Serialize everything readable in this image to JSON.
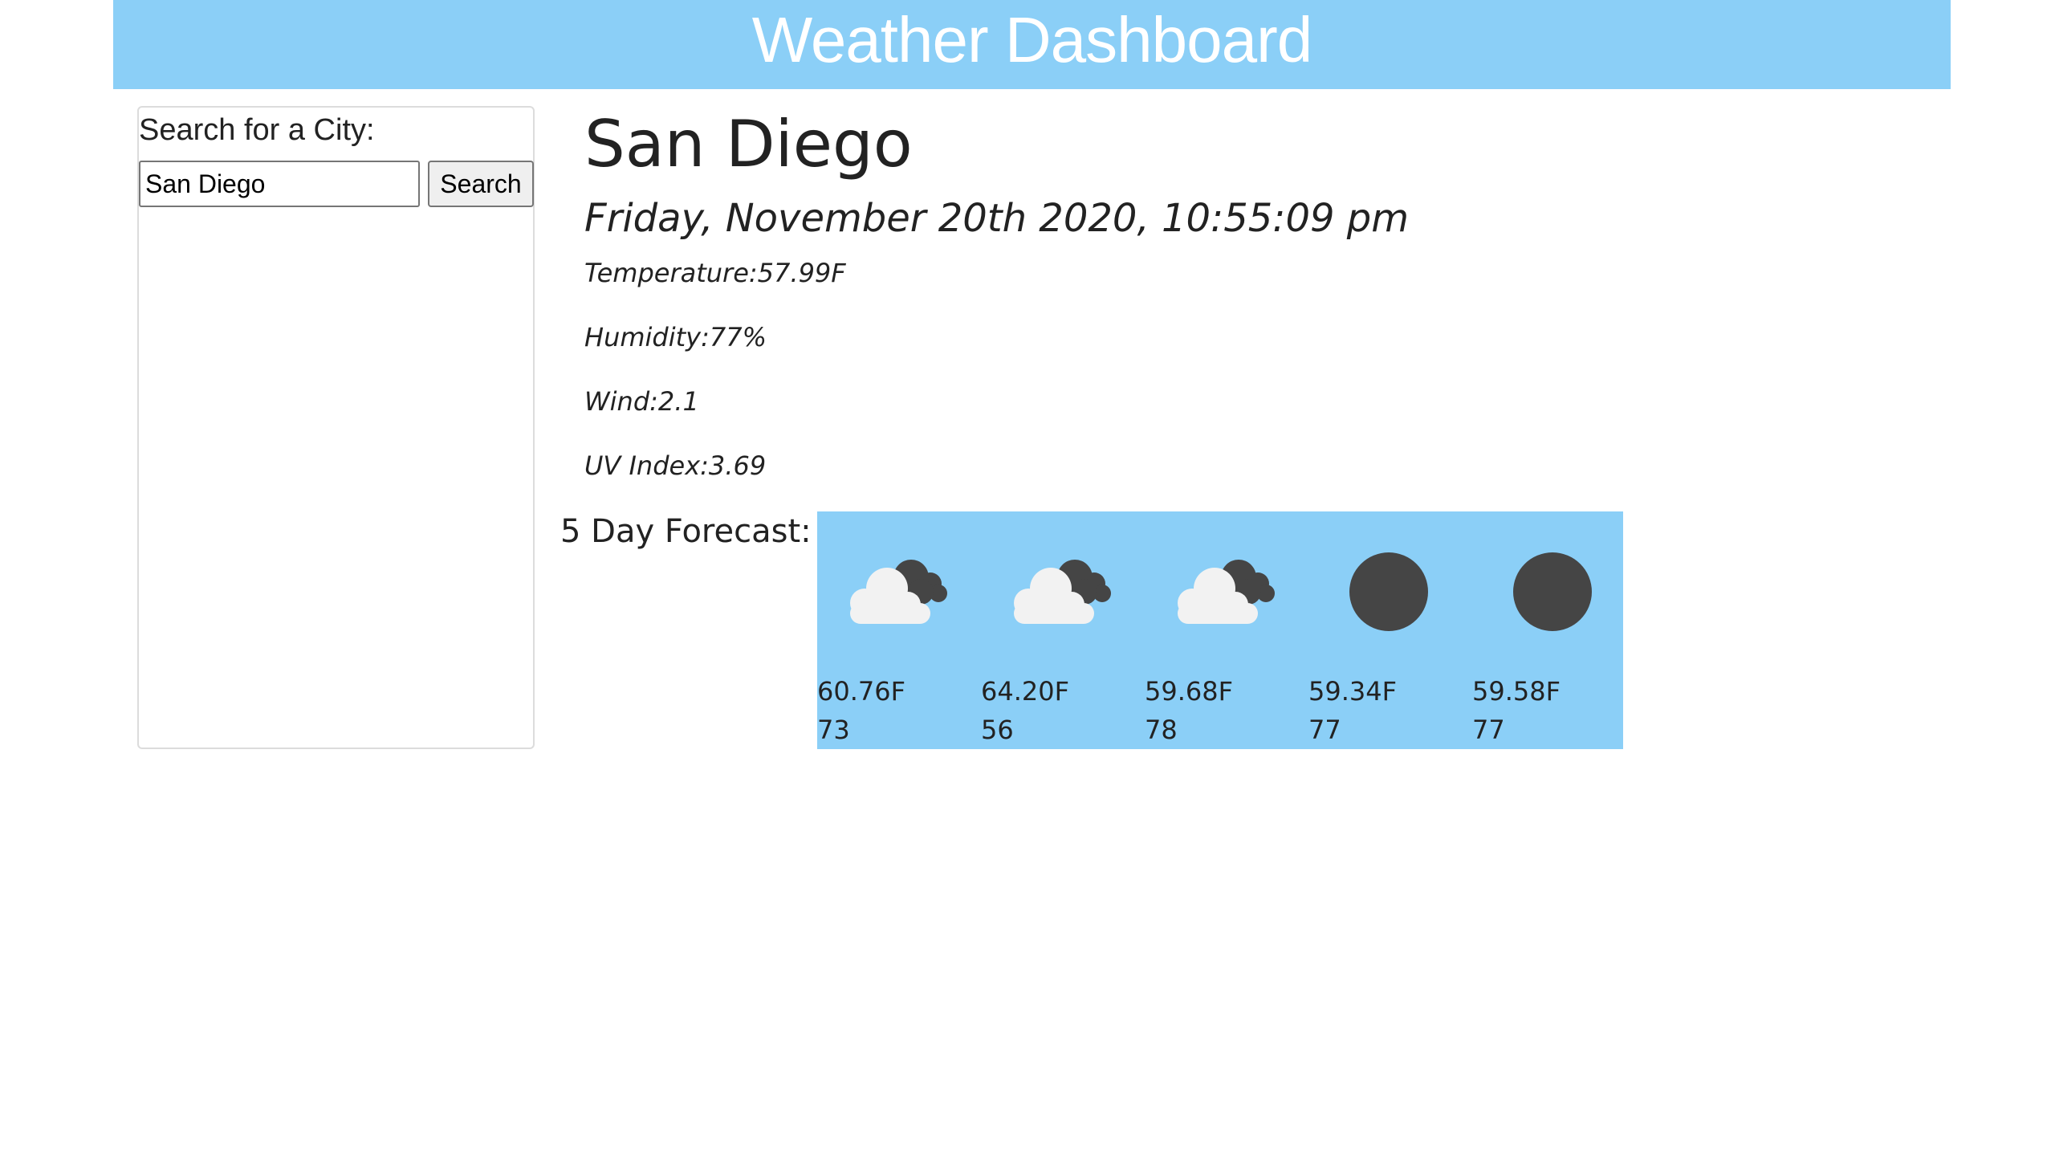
{
  "header": {
    "title": "Weather Dashboard"
  },
  "search": {
    "label": "Search for a City:",
    "input_value": "San Diego",
    "button_label": "Search"
  },
  "current": {
    "city": "San Diego",
    "datetime": "Friday, November 20th 2020, 10:55:09 pm",
    "temperature": "Temperature:57.99F",
    "humidity": "Humidity:77%",
    "wind": "Wind:2.1",
    "uv_index": "UV Index:3.69"
  },
  "forecast": {
    "label": "5 Day Forecast:",
    "days": [
      {
        "icon": "partly-cloudy-night-icon",
        "temp": "60.76F",
        "humidity": "73"
      },
      {
        "icon": "partly-cloudy-night-icon",
        "temp": "64.20F",
        "humidity": "56"
      },
      {
        "icon": "partly-cloudy-night-icon",
        "temp": "59.68F",
        "humidity": "78"
      },
      {
        "icon": "clear-night-icon",
        "temp": "59.34F",
        "humidity": "77"
      },
      {
        "icon": "clear-night-icon",
        "temp": "59.58F",
        "humidity": "77"
      }
    ]
  },
  "colors": {
    "header_bg": "#8bcff7",
    "forecast_bg": "#8bcff7",
    "icon_dark": "#454545",
    "icon_cloud": "#f2f2f2"
  }
}
